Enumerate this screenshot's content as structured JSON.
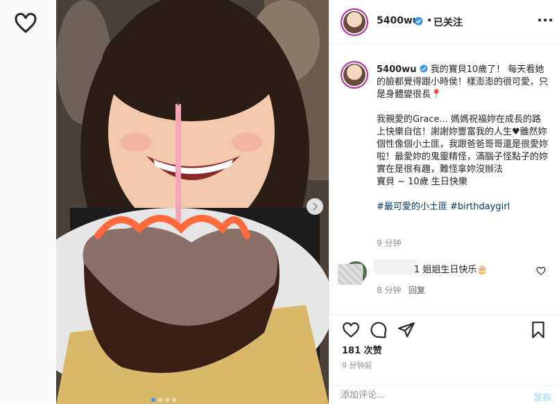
{
  "header": {
    "username": "5400wu",
    "separator": "•",
    "follow_status": "已关注",
    "verified_icon": "verified-badge-icon",
    "more_icon": "more-dots-icon"
  },
  "caption": {
    "username": "5400wu",
    "line1": "我的寶貝10歲了！ 每天看她的臉都覺得跟小時侯！樣澎澎的很可愛，只是身體變很長📍",
    "line2": "我親愛的Grace... 媽媽祝福妳在成長的路上快樂自信！謝謝妳豐富我的人生♥雖然妳個性像個小土匪，我跟爸爸哥哥還是很愛妳啦！最愛妳的鬼靈精怪，滿腦子怪點子的妳實在是很有趣，難怪拿妳沒辦法",
    "line3": "寶貝 ~ 10歲 生日快樂",
    "hashtags": "#最可愛的小土匪 #birthdaygirl",
    "time": "9 分钟"
  },
  "comment": {
    "text": "1 姐姐生日快乐🎂",
    "time": "8 分钟",
    "reply": "回复"
  },
  "actions": {
    "likes": "181 次赞",
    "time": "9 分钟前"
  },
  "comment_bar": {
    "placeholder": "添加评论...",
    "post": "发布"
  },
  "carousel": {
    "slides": 4,
    "active_index": 0
  },
  "colors": {
    "accent": "#3897f0",
    "post_disabled": "#b2dffc",
    "hashtag": "#00376b"
  }
}
